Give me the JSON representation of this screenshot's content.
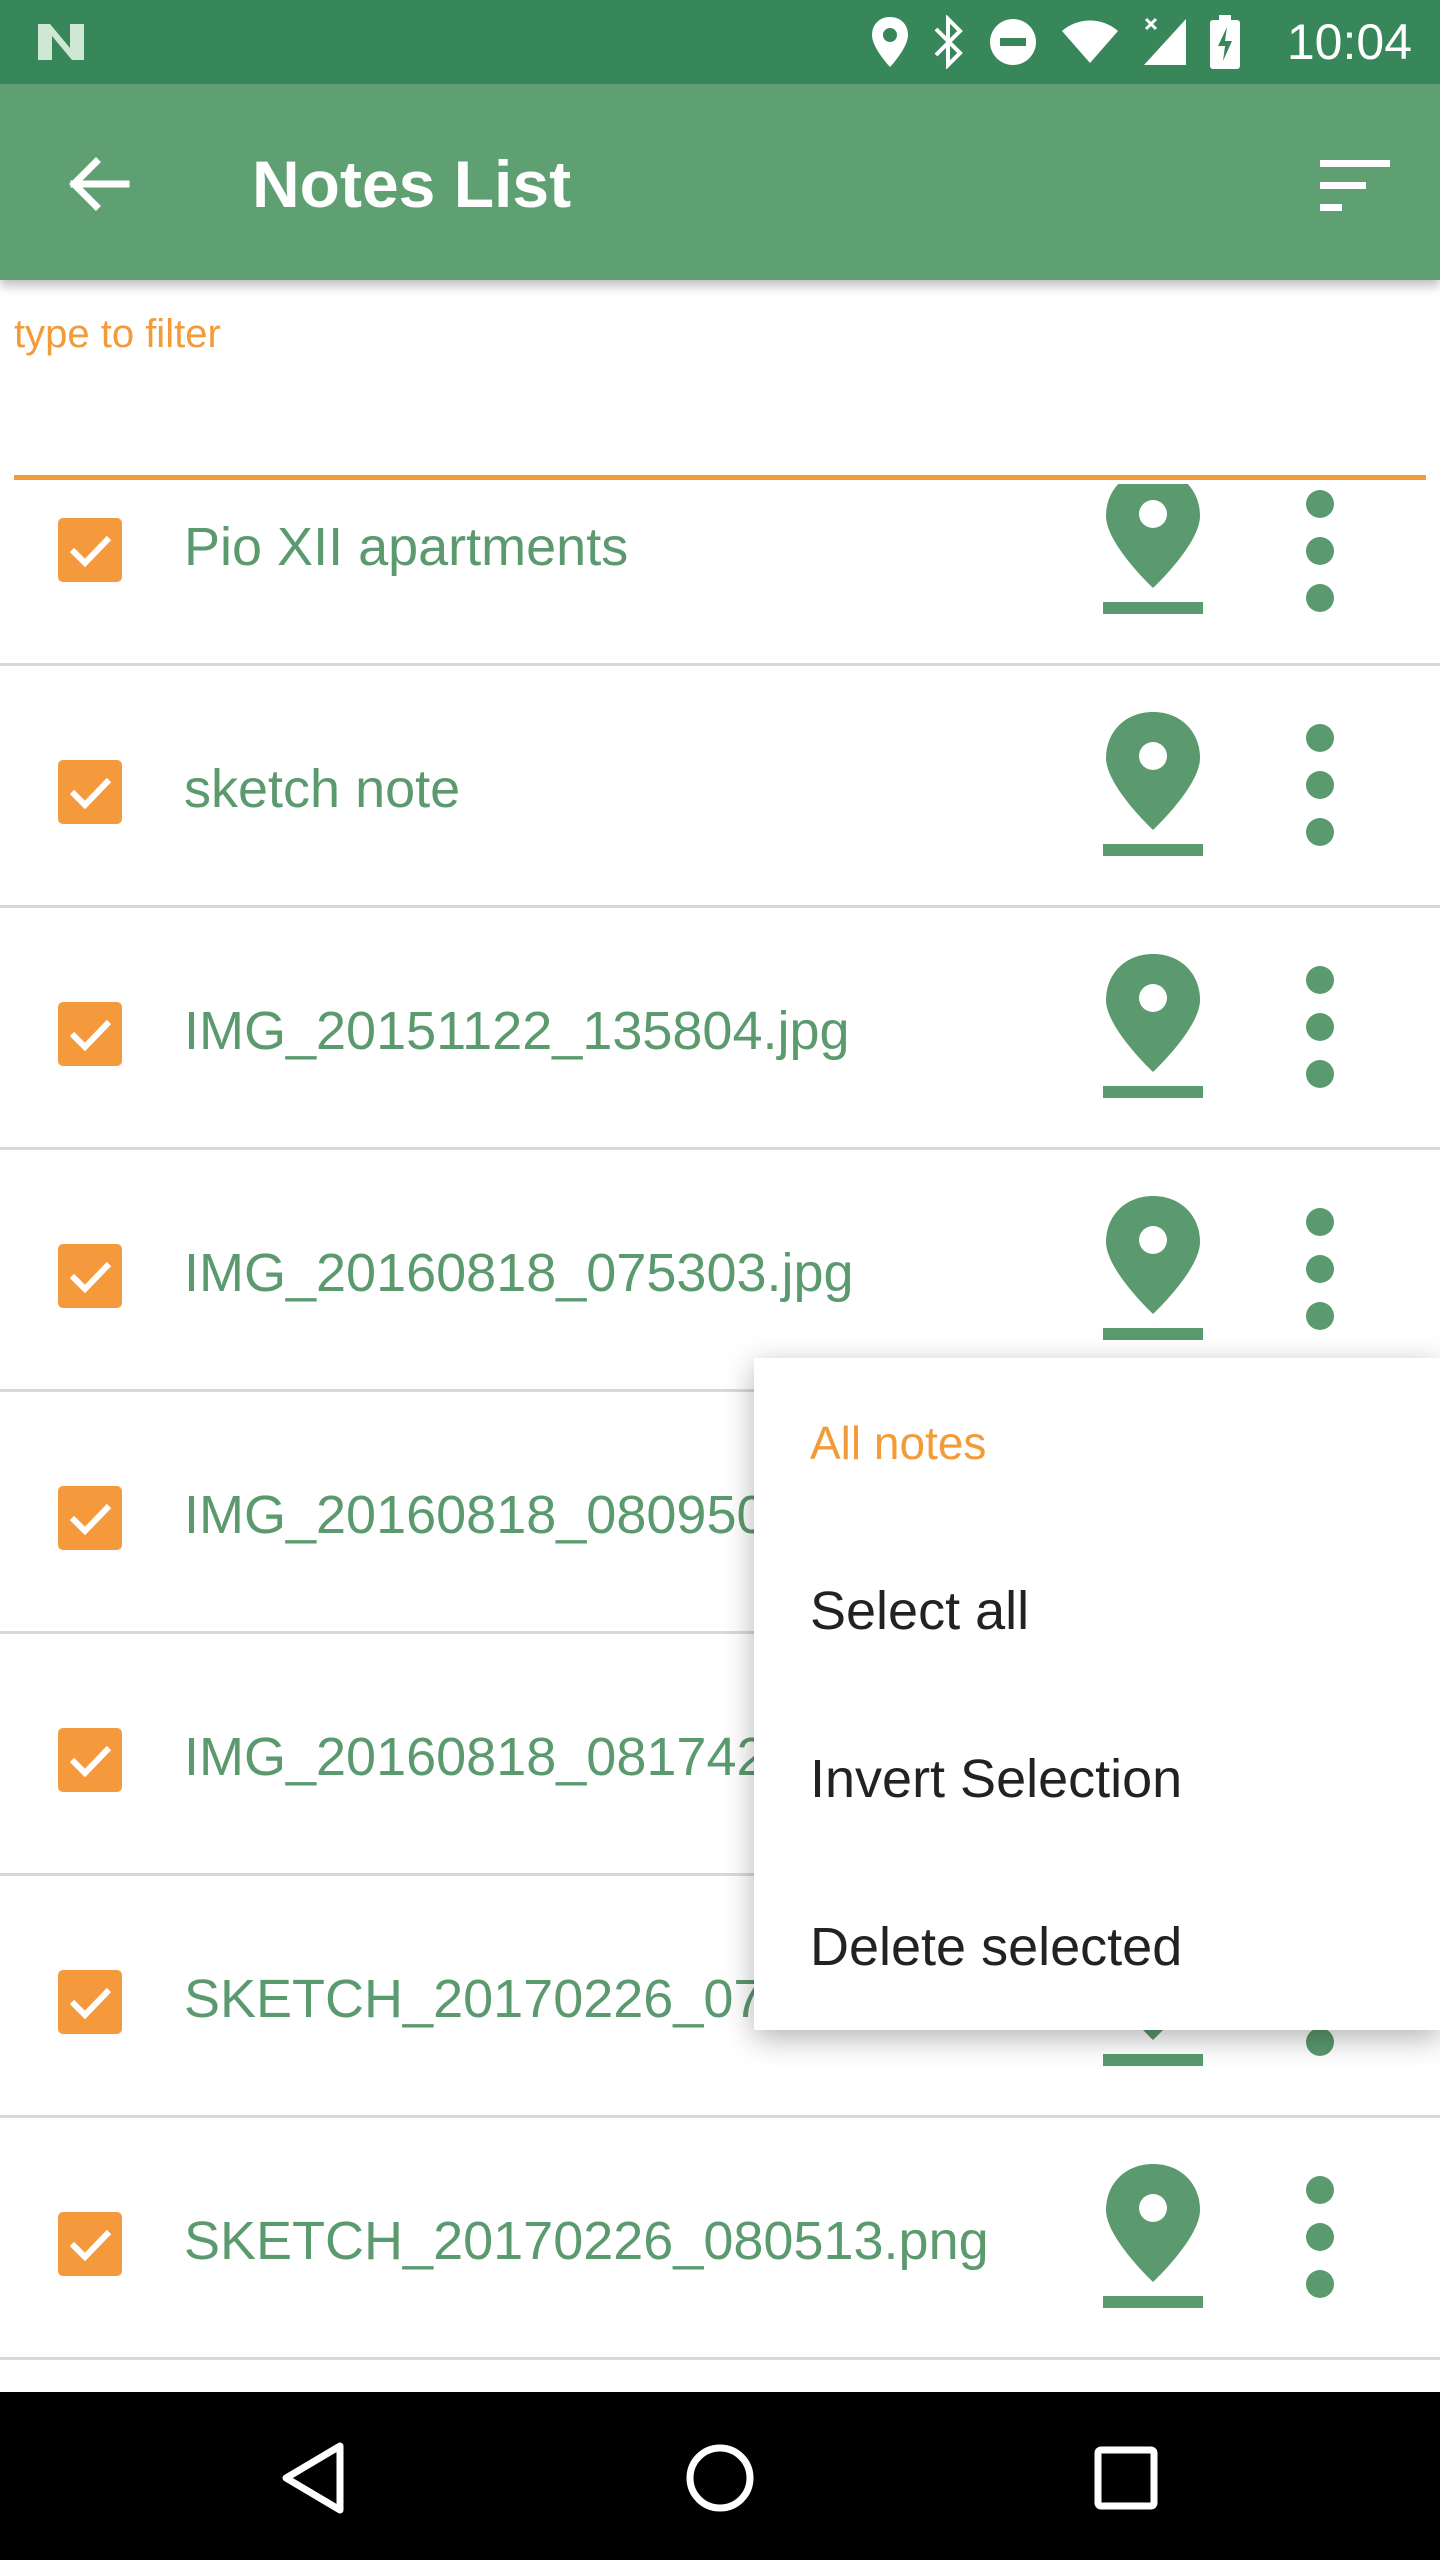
{
  "status_bar": {
    "time": "10:04",
    "icons": [
      "notification-n-icon",
      "location-icon",
      "bluetooth-icon",
      "do-not-disturb-icon",
      "wifi-icon",
      "signal-icon",
      "battery-charging-icon"
    ]
  },
  "app_bar": {
    "title": "Notes List",
    "back_icon": "arrow-back-icon",
    "sort_icon": "sort-icon"
  },
  "filter": {
    "placeholder": "type to filter",
    "value": ""
  },
  "notes": [
    {
      "name": "Pio XII apartments",
      "checked": true
    },
    {
      "name": "sketch note",
      "checked": true
    },
    {
      "name": "IMG_20151122_135804.jpg",
      "checked": true
    },
    {
      "name": "IMG_20160818_075303.jpg",
      "checked": true
    },
    {
      "name": "IMG_20160818_080950",
      "checked": true
    },
    {
      "name": "IMG_20160818_081742",
      "checked": true
    },
    {
      "name": "SKETCH_20170226_07",
      "checked": true
    },
    {
      "name": "SKETCH_20170226_080513.png",
      "checked": true
    }
  ],
  "menu": {
    "header": "All notes",
    "items": [
      "Select all",
      "Invert Selection",
      "Delete selected"
    ]
  },
  "colors": {
    "status_bar": "#38875A",
    "app_bar": "#5FA073",
    "accent": "#F29B38",
    "note_text": "#5A9A6E"
  },
  "nav_bar": {
    "icons": [
      "back-triangle-icon",
      "home-circle-icon",
      "recents-square-icon"
    ]
  }
}
